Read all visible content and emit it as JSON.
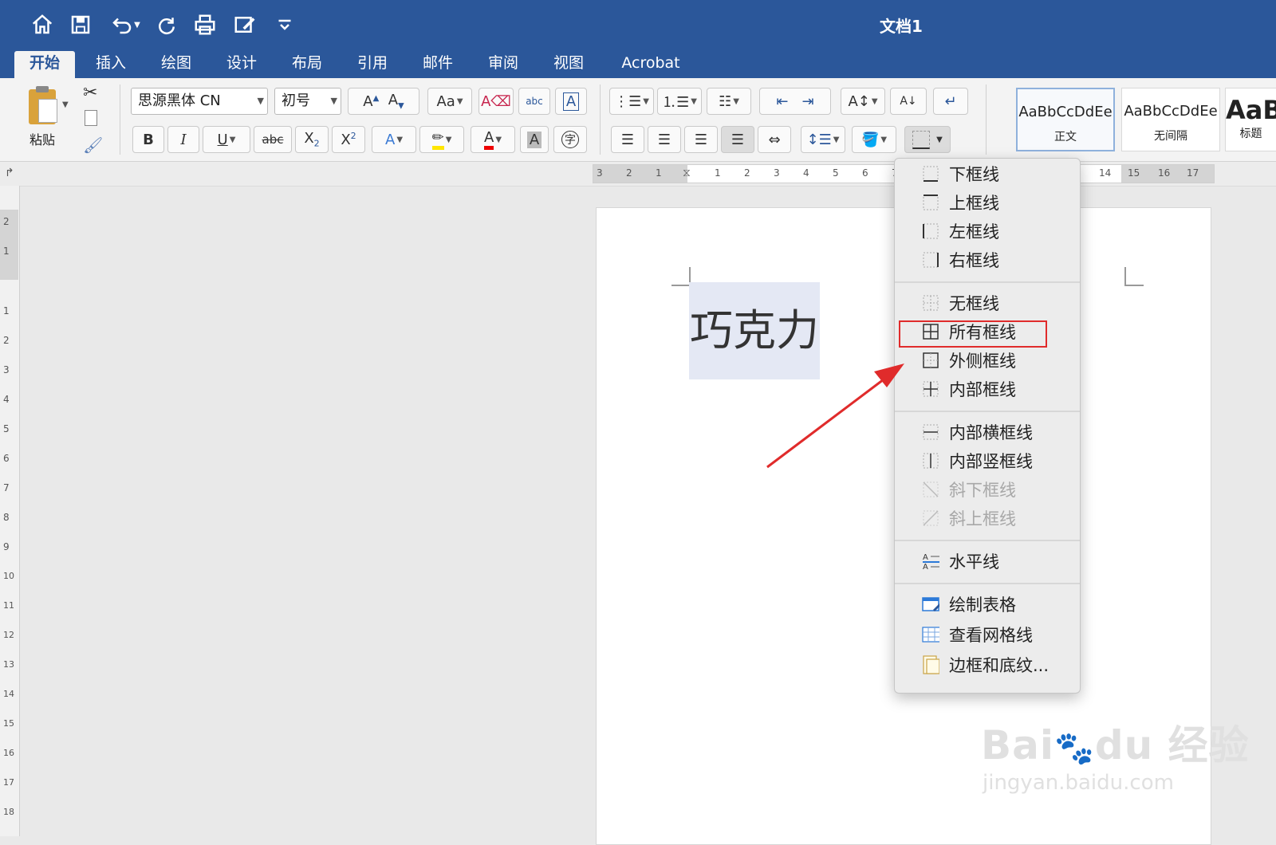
{
  "window": {
    "title": "文档1"
  },
  "tabs": [
    {
      "label": "开始",
      "active": true
    },
    {
      "label": "插入"
    },
    {
      "label": "绘图"
    },
    {
      "label": "设计"
    },
    {
      "label": "布局"
    },
    {
      "label": "引用"
    },
    {
      "label": "邮件"
    },
    {
      "label": "审阅"
    },
    {
      "label": "视图"
    },
    {
      "label": "Acrobat"
    }
  ],
  "ribbon": {
    "paste_label": "粘贴",
    "font_name": "思源黑体 CN",
    "font_size": "初号",
    "styles": [
      {
        "sample": "AaBbCcDdEe",
        "name": "正文",
        "selected": true
      },
      {
        "sample": "AaBbCcDdEe",
        "name": "无间隔"
      },
      {
        "sample": "AaB",
        "name": "标题"
      }
    ]
  },
  "ruler": {
    "h_left_numbers": [
      "3",
      "2",
      "1"
    ],
    "h_numbers": [
      "1",
      "2",
      "3",
      "4",
      "5",
      "6",
      "7"
    ],
    "h_right_numbers": [
      "14",
      "15",
      "16",
      "17"
    ],
    "v_numbers": [
      "2",
      "1",
      "1",
      "2",
      "3",
      "4",
      "5",
      "6",
      "7",
      "8",
      "9",
      "10",
      "11",
      "12",
      "13",
      "14",
      "15",
      "16",
      "17",
      "18"
    ]
  },
  "document": {
    "text": "巧克力",
    "highlight_color": "#e4e8f4"
  },
  "border_menu": {
    "items": [
      {
        "label": "下框线",
        "icon": "bottom-border-icon"
      },
      {
        "label": "上框线",
        "icon": "top-border-icon"
      },
      {
        "label": "左框线",
        "icon": "left-border-icon"
      },
      {
        "label": "右框线",
        "icon": "right-border-icon"
      },
      {
        "label": "无框线",
        "icon": "no-border-icon"
      },
      {
        "label": "所有框线",
        "icon": "all-borders-icon",
        "highlighted": true
      },
      {
        "label": "外侧框线",
        "icon": "outside-borders-icon"
      },
      {
        "label": "内部框线",
        "icon": "inside-borders-icon"
      },
      {
        "label": "内部横框线",
        "icon": "inside-horizontal-border-icon"
      },
      {
        "label": "内部竖框线",
        "icon": "inside-vertical-border-icon"
      },
      {
        "label": "斜下框线",
        "icon": "diagonal-down-border-icon",
        "disabled": true
      },
      {
        "label": "斜上框线",
        "icon": "diagonal-up-border-icon",
        "disabled": true
      },
      {
        "label": "水平线",
        "icon": "horizontal-line-icon"
      },
      {
        "label": "绘制表格",
        "icon": "draw-table-icon"
      },
      {
        "label": "查看网格线",
        "icon": "view-gridlines-icon"
      },
      {
        "label": "边框和底纹...",
        "icon": "borders-shading-icon"
      }
    ]
  },
  "annotation": {
    "highlight_color": "#e02b2b",
    "arrow_color": "#e02b2b"
  },
  "watermark": {
    "brand": "Bai",
    "brand2": "du",
    "brand3": "经验",
    "url": "jingyan.baidu.com"
  }
}
